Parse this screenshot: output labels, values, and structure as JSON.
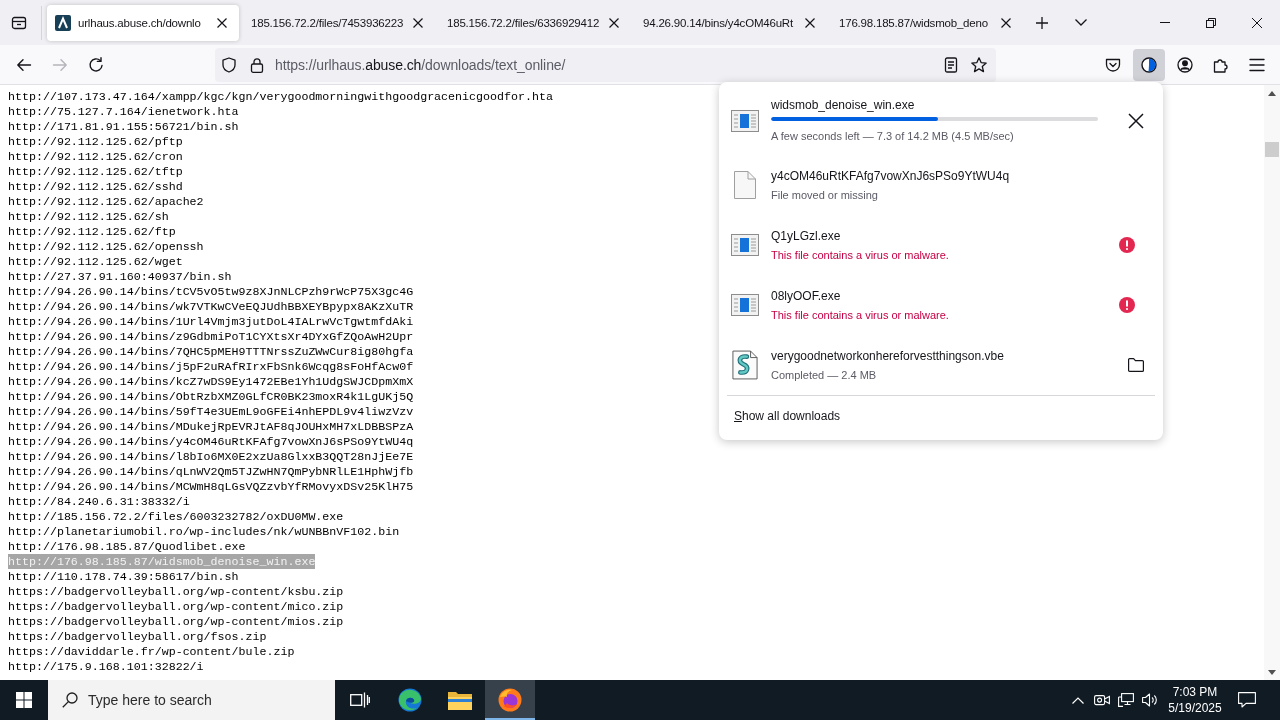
{
  "tab_bar": {
    "tabs": [
      {
        "title": "urlhaus.abuse.ch/downlo",
        "favicon": true,
        "selected": true
      },
      {
        "title": "185.156.72.2/files/7453936223",
        "favicon": false,
        "selected": false
      },
      {
        "title": "185.156.72.2/files/6336929412",
        "favicon": false,
        "selected": false
      },
      {
        "title": "94.26.90.14/bins/y4cOM46uRt",
        "favicon": false,
        "selected": false
      },
      {
        "title": "176.98.185.87/widsmob_deno",
        "favicon": false,
        "selected": false
      }
    ]
  },
  "nav_bar": {
    "url_parts": [
      {
        "text": "https://urlhaus.",
        "emphasis": false
      },
      {
        "text": "abuse.ch",
        "emphasis": true
      },
      {
        "text": "/downloads/text_online/",
        "emphasis": false
      }
    ],
    "forward_disabled": true,
    "downloads_button_open": true
  },
  "page": {
    "lines": [
      {
        "text": "http://107.173.47.164/xampp/kgc/kgn/verygoodmorningwithgoodgracenicgoodfor.hta",
        "selected": false
      },
      {
        "text": "http://75.127.7.164/ienetwork.hta",
        "selected": false
      },
      {
        "text": "http://171.81.91.155:56721/bin.sh",
        "selected": false
      },
      {
        "text": "http://92.112.125.62/pftp",
        "selected": false
      },
      {
        "text": "http://92.112.125.62/cron",
        "selected": false
      },
      {
        "text": "http://92.112.125.62/tftp",
        "selected": false
      },
      {
        "text": "http://92.112.125.62/sshd",
        "selected": false
      },
      {
        "text": "http://92.112.125.62/apache2",
        "selected": false
      },
      {
        "text": "http://92.112.125.62/sh",
        "selected": false
      },
      {
        "text": "http://92.112.125.62/ftp",
        "selected": false
      },
      {
        "text": "http://92.112.125.62/openssh",
        "selected": false
      },
      {
        "text": "http://92.112.125.62/wget",
        "selected": false
      },
      {
        "text": "http://27.37.91.160:40937/bin.sh",
        "selected": false
      },
      {
        "text": "http://94.26.90.14/bins/tCV5vO5tw9z8XJnNLCPzh9rWcP75X3gc4G",
        "selected": false
      },
      {
        "text": "http://94.26.90.14/bins/wk7VTKwCVeEQJUdhBBXEYBpypx8AKzXuTR",
        "selected": false
      },
      {
        "text": "http://94.26.90.14/bins/1Url4Vmjm3jutDoL4IALrwVcTgwtmfdAki",
        "selected": false
      },
      {
        "text": "http://94.26.90.14/bins/z9GdbmiPoT1CYXtsXr4DYxGfZQoAwH2Upr",
        "selected": false
      },
      {
        "text": "http://94.26.90.14/bins/7QHC5pMEH9TTTNrssZuZWwCur8ig80hgfa",
        "selected": false
      },
      {
        "text": "http://94.26.90.14/bins/j5pF2uRAfRIrxFbSnk6Wcqg8sFoHfAcw0f",
        "selected": false
      },
      {
        "text": "http://94.26.90.14/bins/kcZ7wDS9Ey1472EBe1Yh1UdgSWJCDpmXmX",
        "selected": false
      },
      {
        "text": "http://94.26.90.14/bins/ObtRzbXMZ0GLfCR0BK23moxR4k1LgUKj5Q",
        "selected": false
      },
      {
        "text": "http://94.26.90.14/bins/59fT4e3UEmL9oGFEi4nhEPDL9v4liwzVzv",
        "selected": false
      },
      {
        "text": "http://94.26.90.14/bins/MDukejRpEVRJtAF8qJOUHxMH7xLDBBSPzA",
        "selected": false
      },
      {
        "text": "http://94.26.90.14/bins/y4cOM46uRtKFAfg7vowXnJ6sPSo9YtWU4q",
        "selected": false
      },
      {
        "text": "http://94.26.90.14/bins/l8bIo6MX0E2xzUa8GlxxB3QQT28nJjEe7E",
        "selected": false
      },
      {
        "text": "http://94.26.90.14/bins/qLnWV2Qm5TJZwHN7QmPybNRlLE1HphWjfb",
        "selected": false
      },
      {
        "text": "http://94.26.90.14/bins/MCWmH8qLGsVQZzvbYfRMovyxDSv25KlH75",
        "selected": false
      },
      {
        "text": "http://84.240.6.31:38332/i",
        "selected": false
      },
      {
        "text": "http://185.156.72.2/files/6003232782/oxDU0MW.exe",
        "selected": false
      },
      {
        "text": "http://planetariumobil.ro/wp-includes/nk/wUNBBnVF102.bin",
        "selected": false
      },
      {
        "text": "http://176.98.185.87/Quodlibet.exe",
        "selected": false
      },
      {
        "text": "http://176.98.185.87/widsmob_denoise_win.exe",
        "selected": true
      },
      {
        "text": "http://110.178.74.39:58617/bin.sh",
        "selected": false
      },
      {
        "text": "https://badgervolleyball.org/wp-content/ksbu.zip",
        "selected": false
      },
      {
        "text": "https://badgervolleyball.org/wp-content/mico.zip",
        "selected": false
      },
      {
        "text": "https://badgervolleyball.org/wp-content/mios.zip",
        "selected": false
      },
      {
        "text": "https://badgervolleyball.org/fsos.zip",
        "selected": false
      },
      {
        "text": "https://daviddarle.fr/wp-content/bule.zip",
        "selected": false
      },
      {
        "text": "http://175.9.168.101:32822/i",
        "selected": false
      }
    ]
  },
  "downloads_panel": {
    "items": [
      {
        "kind": "downloading",
        "name": "widsmob_denoise_win.exe",
        "level": 0.51,
        "status": "A few seconds left — 7.3 of 14.2 MB (4.5 MB/sec)"
      },
      {
        "kind": "missing",
        "name": "y4cOM46uRtKFAfg7vowXnJ6sPSo9YtWU4q",
        "status": "File moved or missing"
      },
      {
        "kind": "blocked",
        "name": "Q1yLGzl.exe",
        "status": "This file contains a virus or malware."
      },
      {
        "kind": "blocked",
        "name": "08lyOOF.exe",
        "status": "This file contains a virus or malware."
      },
      {
        "kind": "completed",
        "name": "verygoodnetworkonhereforvestthingson.vbe",
        "status": "Completed — 2.4 MB"
      }
    ],
    "show_all_label": "Show all downloads"
  },
  "taskbar": {
    "search": {
      "placeholder": "Type here to search"
    },
    "apps": [
      {
        "kind": "task_view",
        "active": false
      },
      {
        "kind": "web_browser",
        "active": false
      },
      {
        "kind": "file_manager",
        "active": false
      },
      {
        "kind": "fox_browser",
        "active": true
      }
    ],
    "clock": {
      "time": "7:03 PM",
      "date": "5/19/2025"
    }
  }
}
